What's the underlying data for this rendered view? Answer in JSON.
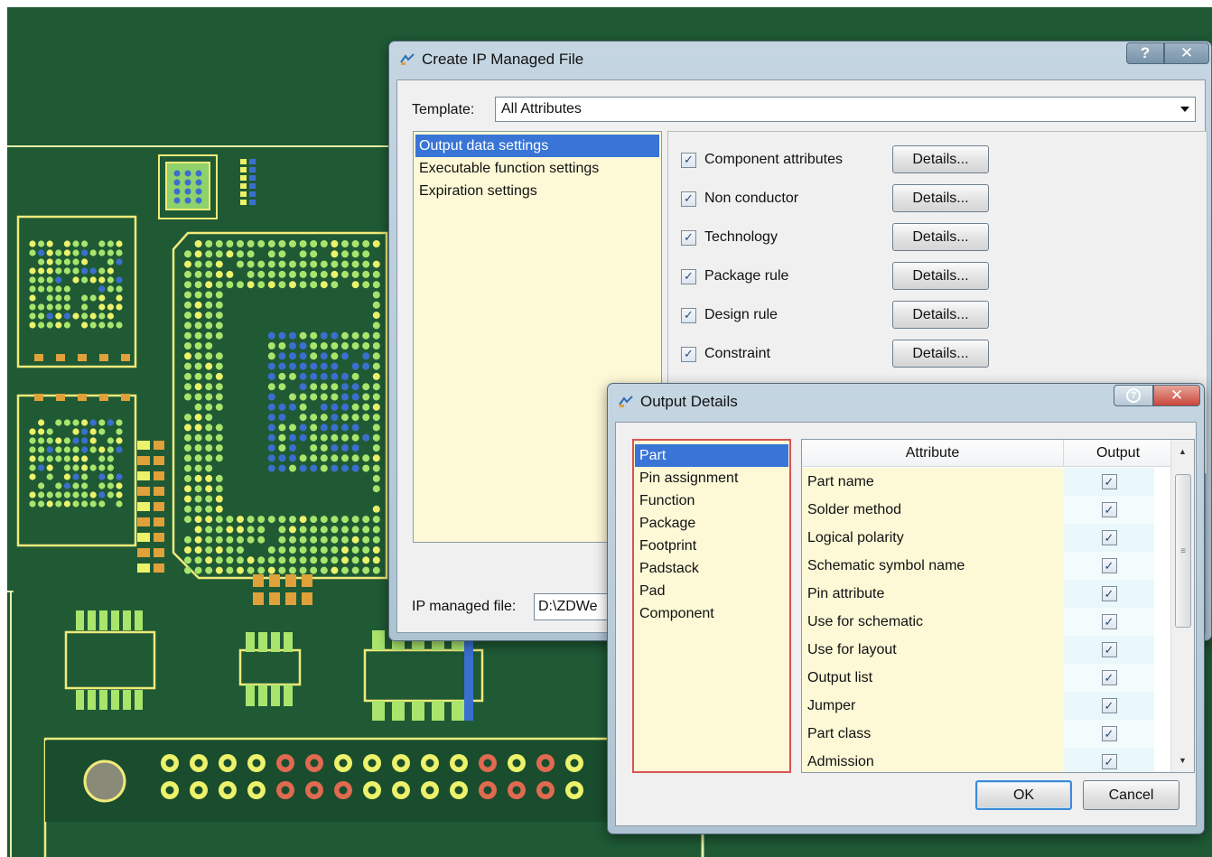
{
  "colors": {
    "board": "#1f5a35",
    "outline": "#f0ea7a",
    "pad_green": "#a9e46c",
    "pad_yellow": "#ecf26a",
    "pad_blue": "#3a6fd0",
    "pad_orange": "#e0a03a",
    "selection": "#3875d7",
    "list_bg": "#fdf9d7"
  },
  "create_dialog": {
    "title": "Create IP Managed File",
    "help_label": "?",
    "close_label": "✕",
    "template_label": "Template:",
    "template_value": "All Attributes",
    "settings": [
      {
        "label": "Output data settings",
        "selected": true
      },
      {
        "label": "Executable function settings",
        "selected": false
      },
      {
        "label": "Expiration settings",
        "selected": false
      }
    ],
    "options": [
      {
        "label": "Component attributes",
        "checked": true,
        "button": "Details..."
      },
      {
        "label": "Non conductor",
        "checked": true,
        "button": "Details..."
      },
      {
        "label": "Technology",
        "checked": true,
        "button": "Details..."
      },
      {
        "label": "Package rule",
        "checked": true,
        "button": "Details..."
      },
      {
        "label": "Design rule",
        "checked": true,
        "button": "Details..."
      },
      {
        "label": "Constraint",
        "checked": true,
        "button": "Details..."
      }
    ],
    "ip_file_label": "IP managed file:",
    "ip_file_value": "D:\\ZDWe"
  },
  "output_dialog": {
    "title": "Output Details",
    "close_label": "✕",
    "categories": [
      {
        "label": "Part",
        "selected": true
      },
      {
        "label": "Pin assignment",
        "selected": false
      },
      {
        "label": "Function",
        "selected": false
      },
      {
        "label": "Package",
        "selected": false
      },
      {
        "label": "Footprint",
        "selected": false
      },
      {
        "label": "Padstack",
        "selected": false
      },
      {
        "label": "Pad",
        "selected": false
      },
      {
        "label": "Component",
        "selected": false
      }
    ],
    "columns": {
      "attribute": "Attribute",
      "output": "Output"
    },
    "attributes": [
      {
        "name": "Part name",
        "output": true
      },
      {
        "name": "Solder method",
        "output": true
      },
      {
        "name": "Logical polarity",
        "output": true
      },
      {
        "name": "Schematic symbol name",
        "output": true
      },
      {
        "name": "Pin attribute",
        "output": true
      },
      {
        "name": "Use for schematic",
        "output": true
      },
      {
        "name": "Use for layout",
        "output": true
      },
      {
        "name": "Output list",
        "output": true
      },
      {
        "name": "Jumper",
        "output": true
      },
      {
        "name": "Part class",
        "output": true
      },
      {
        "name": "Admission",
        "output": true
      }
    ],
    "ok_label": "OK",
    "cancel_label": "Cancel"
  }
}
